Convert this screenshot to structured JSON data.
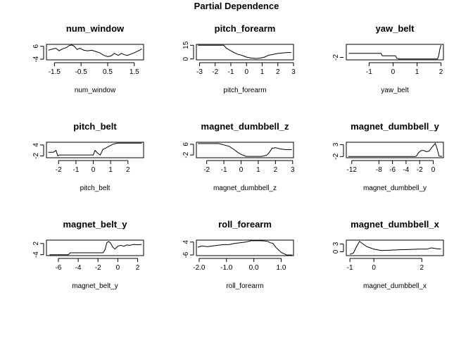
{
  "figure_title": "Partial Dependence",
  "chart_data": [
    {
      "type": "line",
      "title": "num_window",
      "xlabel": "num_window",
      "ylabel": "",
      "xlim": [
        -1.8,
        1.85
      ],
      "ylim": [
        -4.5,
        7.5
      ],
      "xticks": [
        -1.5,
        -0.5,
        0.5,
        1.5
      ],
      "xtick_labels": [
        "-1.5",
        "-0.5",
        "0.5",
        "1.5"
      ],
      "yticks": [
        -4,
        6
      ],
      "ytick_labels": [
        "-4",
        "6"
      ],
      "series": [
        {
          "x": [
            -1.73,
            -1.55,
            -1.45,
            -1.32,
            -1.2,
            -1.05,
            -0.95,
            -0.85,
            -0.75,
            -0.65,
            -0.55,
            -0.4,
            -0.25,
            -0.1,
            0.05,
            0.2,
            0.35,
            0.5,
            0.62,
            0.75,
            0.9,
            1.02,
            1.12,
            1.25,
            1.38,
            1.5,
            1.6,
            1.7,
            1.78
          ],
          "y": [
            3,
            4,
            4.5,
            2.5,
            4,
            5,
            6.5,
            7,
            6,
            3.5,
            4.5,
            3,
            2.5,
            3,
            2,
            1,
            -1,
            -2,
            -1.5,
            0.5,
            -1,
            0.5,
            -0.5,
            -1,
            0,
            1,
            2,
            3,
            4
          ]
        }
      ]
    },
    {
      "type": "line",
      "title": "pitch_forearm",
      "xlabel": "pitch_forearm",
      "ylabel": "",
      "xlim": [
        -3.2,
        3.0
      ],
      "ylim": [
        -1,
        16
      ],
      "xticks": [
        -3,
        -2,
        -1,
        0,
        1,
        2,
        3
      ],
      "xtick_labels": [
        "-3",
        "-2",
        "-1",
        "0",
        "1",
        "2",
        "3"
      ],
      "yticks": [
        0,
        15
      ],
      "ytick_labels": [
        "0",
        "15"
      ],
      "series": [
        {
          "x": [
            -3.1,
            -1.45,
            -1.3,
            -1.1,
            -0.8,
            -0.55,
            -0.3,
            0,
            0.3,
            0.6,
            0.9,
            1.15,
            1.4,
            1.7,
            2.0,
            2.3,
            2.6,
            2.85
          ],
          "y": [
            15,
            15,
            12,
            10,
            7,
            5,
            4,
            2,
            1,
            0.5,
            1,
            2,
            4,
            5,
            6,
            6.5,
            7,
            7
          ]
        }
      ]
    },
    {
      "type": "line",
      "title": "yaw_belt",
      "xlabel": "yaw_belt",
      "ylabel": "",
      "xlim": [
        -1.95,
        2.1
      ],
      "ylim": [
        -3.5,
        6
      ],
      "xticks": [
        -1,
        0,
        1,
        2
      ],
      "xtick_labels": [
        "-1",
        "0",
        "1",
        "2"
      ],
      "yticks": [
        -2
      ],
      "ytick_labels": [
        "-2"
      ],
      "series": [
        {
          "x": [
            -1.85,
            -0.5,
            -0.45,
            -0.2,
            0.1,
            0.15,
            0.25,
            0.3,
            1.85,
            1.9,
            1.95,
            2.0
          ],
          "y": [
            0.5,
            0.5,
            -1,
            -1,
            -1,
            -2.5,
            -3,
            -3,
            -3,
            -1,
            3,
            5.5
          ]
        }
      ]
    },
    {
      "type": "line",
      "title": "pitch_belt",
      "xlabel": "pitch_belt",
      "ylabel": "",
      "xlim": [
        -2.7,
        2.9
      ],
      "ylim": [
        -3,
        5.5
      ],
      "xticks": [
        -2,
        -1,
        0,
        1,
        2
      ],
      "xtick_labels": [
        "-2",
        "-1",
        "0",
        "1",
        "2"
      ],
      "yticks": [
        -2,
        4
      ],
      "ytick_labels": [
        "-2",
        "4"
      ],
      "series": [
        {
          "x": [
            -2.6,
            -2.3,
            -2.15,
            -2.05,
            -1.95,
            -1.5,
            -0.5,
            0,
            0.1,
            0.25,
            0.4,
            0.55,
            0.65,
            0.75,
            0.95,
            1.15,
            1.4,
            1.6,
            2.8
          ],
          "y": [
            0,
            0,
            1,
            -2,
            -1.5,
            -1.5,
            -1.5,
            -1.5,
            1,
            -0.5,
            -1.5,
            1.5,
            2,
            2.5,
            3.5,
            4.5,
            5,
            5,
            5
          ]
        }
      ]
    },
    {
      "type": "line",
      "title": "magnet_dumbbell_z",
      "xlabel": "magnet_dumbbell_z",
      "ylabel": "",
      "xlim": [
        -2.6,
        3.05
      ],
      "ylim": [
        -4,
        7.5
      ],
      "xticks": [
        -2,
        -1,
        0,
        1,
        2,
        3
      ],
      "xtick_labels": [
        "-2",
        "-1",
        "0",
        "1",
        "2",
        "3"
      ],
      "yticks": [
        -2,
        6
      ],
      "ytick_labels": [
        "-2",
        "6"
      ],
      "series": [
        {
          "x": [
            -2.5,
            -1.3,
            -1.0,
            -0.7,
            -0.4,
            -0.2,
            0,
            0.3,
            0.6,
            0.9,
            1.2,
            1.5,
            1.65,
            1.8,
            2.0,
            2.3,
            2.6,
            2.95
          ],
          "y": [
            6.5,
            6.5,
            5.5,
            4.5,
            2,
            0,
            -1.5,
            -3,
            -3,
            -3,
            -3,
            -2,
            0,
            3,
            3.5,
            2.5,
            2,
            2
          ]
        }
      ]
    },
    {
      "type": "line",
      "title": "magnet_dumbbell_y",
      "xlabel": "magnet_dumbbell_y",
      "ylabel": "",
      "xlim": [
        -12.8,
        1.5
      ],
      "ylim": [
        -2.5,
        4
      ],
      "xticks": [
        -12,
        -8,
        -6,
        -4,
        -2,
        0
      ],
      "xtick_labels": [
        "-12",
        "-8",
        "-6",
        "-4",
        "-2",
        "0"
      ],
      "yticks": [
        -2,
        3
      ],
      "ytick_labels": [
        "-2",
        "3"
      ],
      "series": [
        {
          "x": [
            -12.5,
            -2.6,
            -2.4,
            -2.2,
            -1.8,
            -1.4,
            -1.0,
            -0.6,
            -0.3,
            0,
            0.3,
            0.55,
            0.85,
            1.3
          ],
          "y": [
            -2,
            -2,
            -1.5,
            -0.5,
            0.5,
            0.5,
            0,
            0.3,
            1.5,
            2.5,
            3.5,
            1.5,
            -1.8,
            -2
          ]
        }
      ]
    },
    {
      "type": "line",
      "title": "magnet_belt_y",
      "xlabel": "magnet_belt_y",
      "ylabel": "",
      "xlim": [
        -7.2,
        2.6
      ],
      "ylim": [
        -4.5,
        3.8
      ],
      "xticks": [
        -6,
        -4,
        -2,
        0,
        2
      ],
      "xtick_labels": [
        "-6",
        "-4",
        "-2",
        "0",
        "2"
      ],
      "yticks": [
        -4,
        2
      ],
      "ytick_labels": [
        "-4",
        "2"
      ],
      "series": [
        {
          "x": [
            -6.9,
            -5.0,
            -4.8,
            -3.0,
            -1.5,
            -1.3,
            -1.1,
            -0.9,
            -0.7,
            -0.5,
            -0.3,
            0,
            0.3,
            0.6,
            0.9,
            1.2,
            1.6,
            2.0,
            2.4
          ],
          "y": [
            -4,
            -4,
            -3,
            -3,
            -3,
            -1.5,
            2.5,
            3,
            2,
            0,
            -1,
            0.5,
            1,
            0.5,
            1.2,
            1,
            1.5,
            1.3,
            1.5
          ]
        }
      ]
    },
    {
      "type": "line",
      "title": "roll_forearm",
      "xlabel": "roll_forearm",
      "ylabel": "",
      "xlim": [
        -2.1,
        1.45
      ],
      "ylim": [
        -6.5,
        5.5
      ],
      "xticks": [
        -2.0,
        -1.0,
        0.0,
        1.0
      ],
      "xtick_labels": [
        "-2.0",
        "-1.0",
        "0.0",
        "1.0"
      ],
      "yticks": [
        -6,
        4
      ],
      "ytick_labels": [
        "-6",
        "4"
      ],
      "series": [
        {
          "x": [
            -2.05,
            -1.9,
            -1.7,
            -1.5,
            -1.3,
            -1.1,
            -0.9,
            -0.7,
            -0.5,
            -0.3,
            -0.1,
            0.1,
            0.3,
            0.5,
            0.6,
            0.7,
            0.8,
            0.9,
            1.0,
            1.1,
            1.2,
            1.3,
            1.4
          ],
          "y": [
            0,
            1,
            0.5,
            1,
            1.5,
            2,
            2,
            3,
            3.5,
            4,
            5,
            5,
            5,
            4.5,
            3.5,
            3,
            0,
            -2,
            -4,
            -5,
            -6,
            -6,
            -6
          ]
        }
      ]
    },
    {
      "type": "line",
      "title": "magnet_dumbbell_x",
      "xlabel": "magnet_dumbbell_x",
      "ylabel": "",
      "xlim": [
        -1.15,
        2.9
      ],
      "ylim": [
        -1.5,
        4.5
      ],
      "xticks": [
        -1,
        0,
        2
      ],
      "xtick_labels": [
        "-1",
        "0",
        "2"
      ],
      "yticks": [
        0,
        3
      ],
      "ytick_labels": [
        "0",
        "3"
      ],
      "series": [
        {
          "x": [
            -1.0,
            -0.85,
            -0.75,
            -0.6,
            -0.45,
            -0.3,
            -0.15,
            0,
            0.3,
            0.7,
            1.1,
            1.5,
            1.9,
            2.2,
            2.4,
            2.6,
            2.8
          ],
          "y": [
            -1,
            -0.5,
            1.5,
            4,
            3,
            2,
            1.5,
            1,
            0.5,
            0.6,
            0.8,
            0.9,
            1,
            1,
            1.5,
            1.2,
            1
          ]
        }
      ]
    }
  ]
}
